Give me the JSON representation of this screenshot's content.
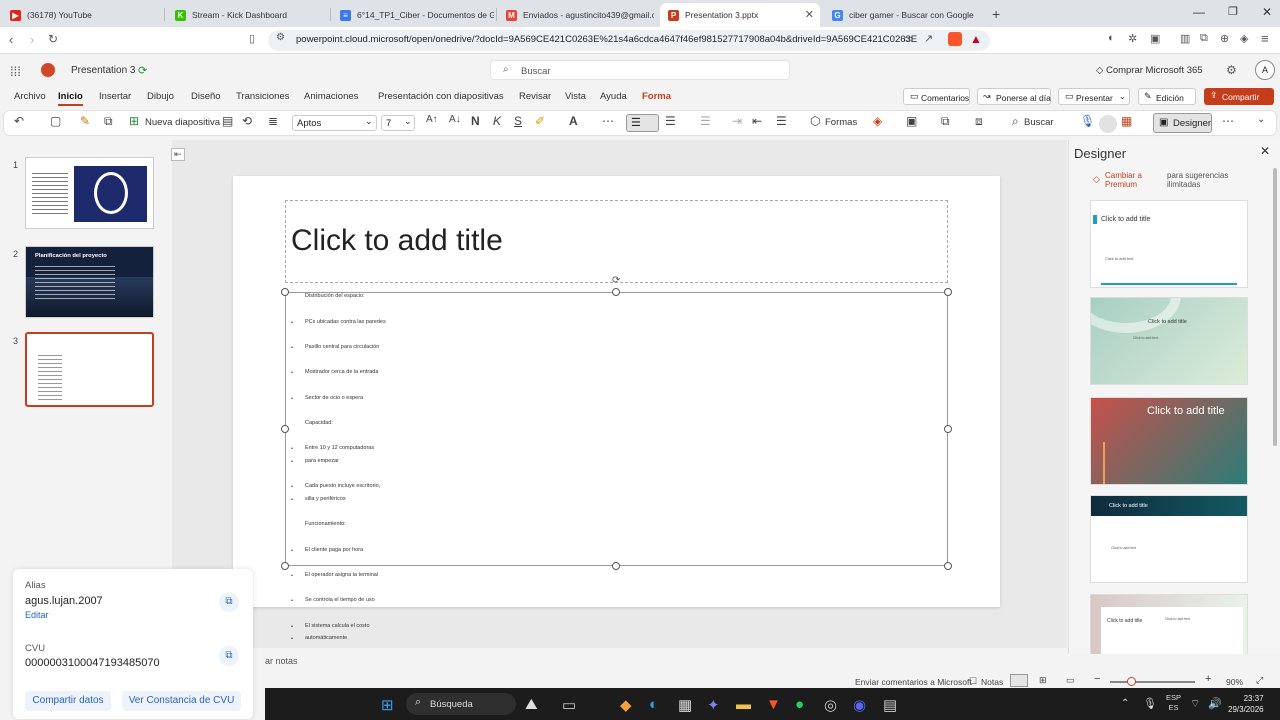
{
  "browser": {
    "tabs": [
      {
        "label": "(36178) YouTube",
        "color": "#e62117",
        "glyph": "▶"
      },
      {
        "label": "Stream - Kick Dashboard",
        "color": "#35c300",
        "glyph": "K"
      },
      {
        "label": "6°14_TP1_Ciber - Documentos de Go",
        "color": "#3a78f2",
        "glyph": "≡"
      },
      {
        "label": "Enviados - agustincito439@gmail.co",
        "color": "#ea4335",
        "glyph": "M"
      },
      {
        "label": "Presentation 3.pptx",
        "color": "#c43e1c",
        "glyph": "P"
      },
      {
        "label": "ciber gamer - Buscar con Google",
        "color": "#4285f4",
        "glyph": "G"
      }
    ],
    "url": "powerpoint.cloud.microsoft/open/onedrive/?docId=9A569CE421C0263E%21s4a6cdca4647f46ef981527717908a04b&driveId=9A569CE421C0263E"
  },
  "app": {
    "doc_title": "Presentation 3",
    "search_placeholder": "Buscar",
    "buy": "Comprar Microsoft 365",
    "avatar": "A",
    "menu": [
      "Archivo",
      "Inicio",
      "Insertar",
      "Dibujo",
      "Diseño",
      "Transiciones",
      "Animaciones",
      "Presentación con diapositivas",
      "Revisar",
      "Vista",
      "Ayuda",
      "Forma"
    ],
    "comentarios": "Comentarios",
    "ponerse": "Ponerse al día",
    "presentar": "Presentar",
    "edicion": "Edición",
    "compartir": "Compartir"
  },
  "ribbon": {
    "new_slide": "Nueva diapositiva",
    "font": "Aptos",
    "size": "7",
    "formas": "Formas",
    "buscar": "Buscar",
    "designer": "Designer"
  },
  "thumbs": {
    "numbers": [
      "1",
      "2",
      "3"
    ],
    "slide2_title": "Planificación del proyecto"
  },
  "slide": {
    "title_placeholder": "Click to add title",
    "bullets": [
      "Distribución del espacio:",
      "PCs ubicadas contra las paredes",
      "Pasillo central para circulación",
      "Mostrador cerca de la entrada",
      "Sector de ocio o espera",
      "Capacidad:",
      "Entre 10 y 12 computadoras",
      "para empezar",
      "Cada puesto incluye escritorio,",
      "silla y periféricos",
      "Funcionamiento:",
      "El cliente paga por hora",
      "El operador asigna la terminal",
      "Se controla el tiempo de uso",
      "El sistema calcula el costo",
      "automáticamente"
    ]
  },
  "designer": {
    "title": "Designer",
    "premium": "Cambiar a Premium",
    "premium_note": "para sugerencias ilimitadas",
    "card_title": "Click to add title",
    "card_sub": "Click to add text"
  },
  "status": {
    "notes": "ar notas",
    "feedback": "Enviar comentarios a Microsoft",
    "notas": "Notas",
    "zoom": "90%"
  },
  "alias_panel": {
    "alias_label": "Alias",
    "alias_value": "agus.lujan.2007",
    "edit": "Editar",
    "cvu_label": "CVU",
    "cvu_value": "0000003100047193485070",
    "share": "Compartir datos",
    "certificate": "Ver Constancia de CVU"
  },
  "taskbar": {
    "search": "Búsqueda",
    "lang1": "ESP",
    "lang2": "ES",
    "time": "23:37",
    "date": "29/3/2026"
  }
}
